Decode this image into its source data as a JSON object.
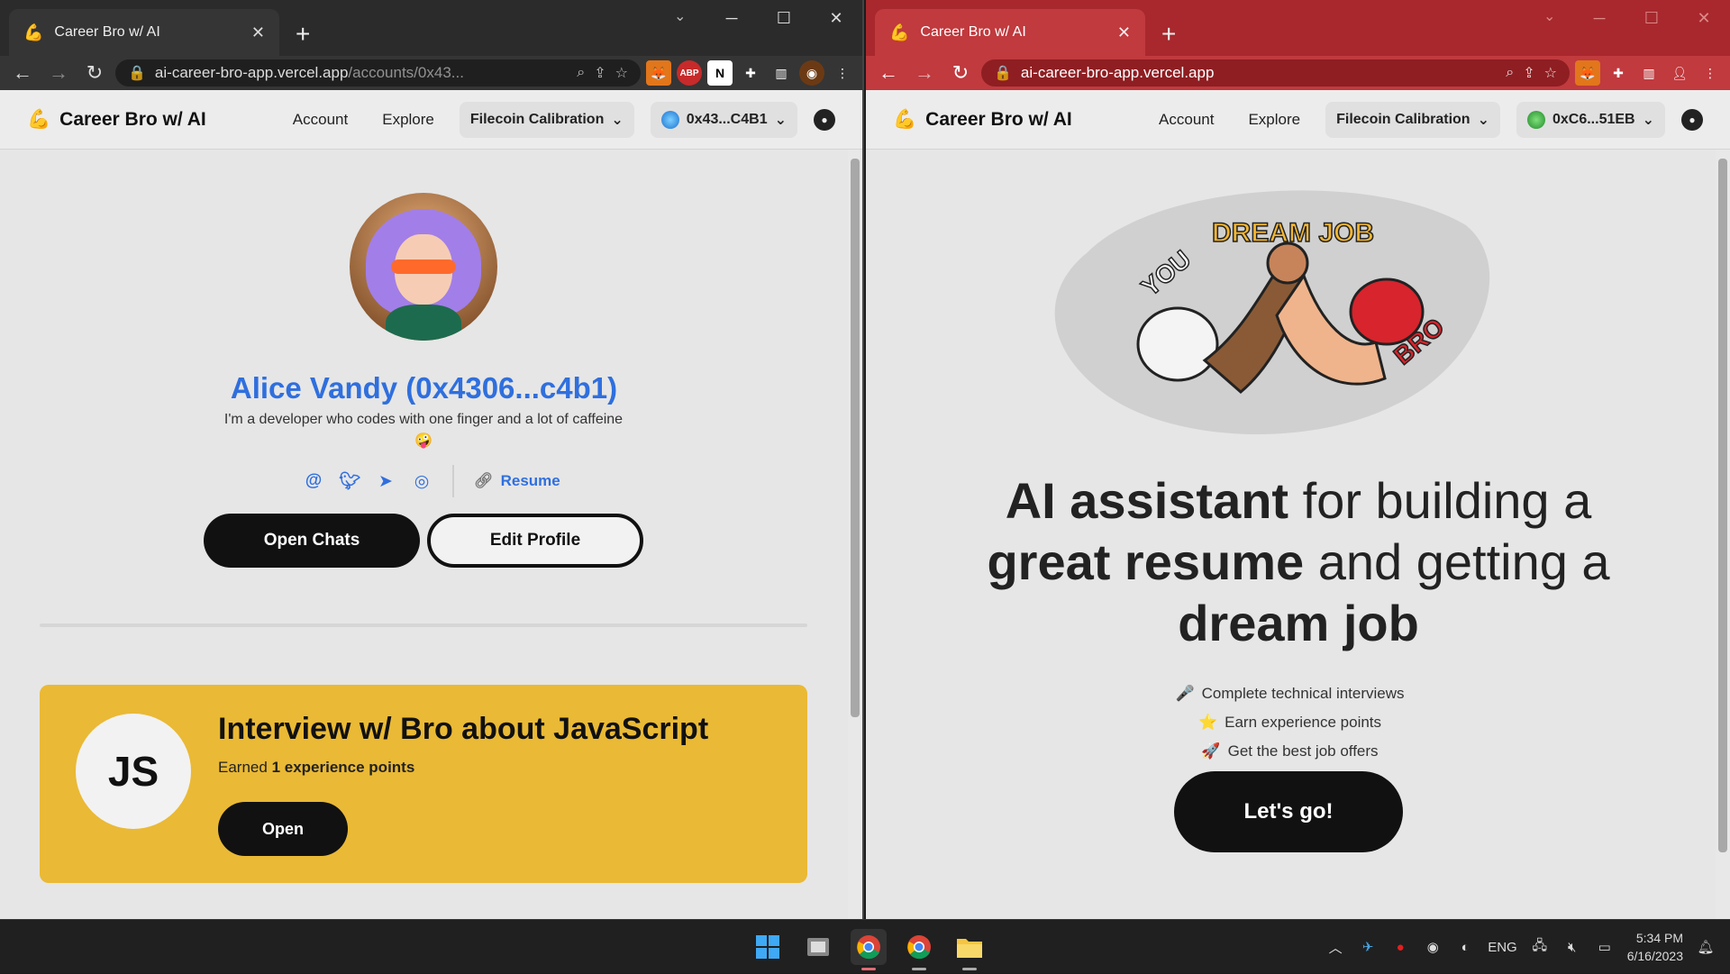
{
  "left_window": {
    "tab_title": "Career Bro w/ AI",
    "url_main": "ai-career-bro-app.vercel.app",
    "url_path": "/accounts/0x43...",
    "app": {
      "brand": "Career Bro w/ AI",
      "nav": [
        "Account",
        "Explore"
      ],
      "network": "Filecoin Calibration",
      "wallet": "0x43...C4B1"
    },
    "profile": {
      "name": "Alice Vandy (0x4306...c4b1)",
      "bio": "I'm a developer who codes with one finger and a lot of caffeine 🤪",
      "resume_label": "Resume",
      "open_chats_label": "Open Chats",
      "edit_profile_label": "Edit Profile"
    },
    "interview_card": {
      "badge": "JS",
      "title": "Interview w/ Bro about JavaScript",
      "earned_prefix": "Earned",
      "earned_value": "1 experience points",
      "open_label": "Open"
    }
  },
  "right_window": {
    "tab_title": "Career Bro w/ AI",
    "url_main": "ai-career-bro-app.vercel.app",
    "app": {
      "brand": "Career Bro w/ AI",
      "nav": [
        "Account",
        "Explore"
      ],
      "network": "Filecoin Calibration",
      "wallet": "0xC6...51EB"
    },
    "hero": {
      "banner": "DREAM JOB",
      "left_label": "YOU",
      "right_label": "BRO"
    },
    "headline": {
      "p1_bold": "AI assistant",
      "p1": " for building a",
      "p2_bold": "great resume",
      "p2": " and getting a",
      "p3_bold": "dream job"
    },
    "features": [
      {
        "icon": "🎤",
        "text": "Complete technical interviews"
      },
      {
        "icon": "⭐",
        "text": "Earn experience points"
      },
      {
        "icon": "🚀",
        "text": "Get the best job offers"
      }
    ],
    "cta": "Let's go!"
  },
  "taskbar": {
    "language": "ENG",
    "time": "5:34 PM",
    "date": "6/16/2023"
  }
}
